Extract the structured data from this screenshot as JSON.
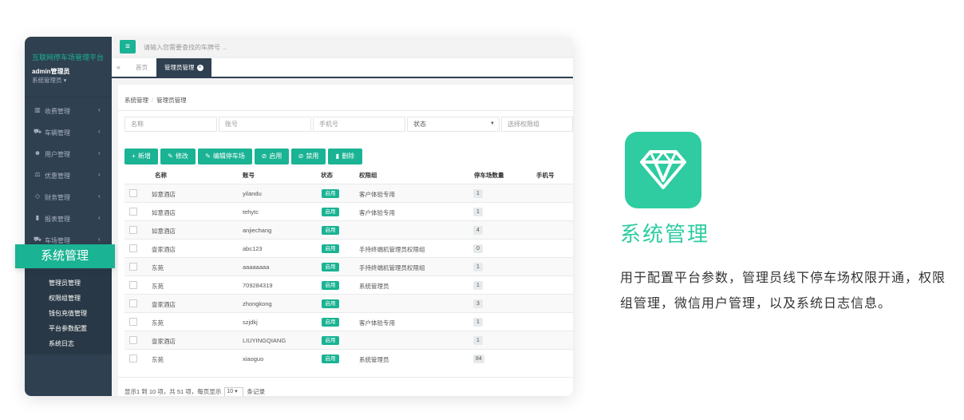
{
  "sidebar": {
    "brand": "互联网停车场管理平台",
    "user_name": "admin管理员",
    "user_role": "系统管理员 ▾",
    "items": [
      {
        "label": "收费管理",
        "icon": "barcode-icon"
      },
      {
        "label": "车辆管理",
        "icon": "car-icon"
      },
      {
        "label": "用户管理",
        "icon": "users-icon"
      },
      {
        "label": "优惠管理",
        "icon": "balance-scale-icon"
      },
      {
        "label": "财务管理",
        "icon": "diamond-icon"
      },
      {
        "label": "报表管理",
        "icon": "bar-chart-icon"
      },
      {
        "label": "车场管理",
        "icon": "car-icon"
      }
    ],
    "submenu": [
      "管理员管理",
      "权限组管理",
      "钱包充值管理",
      "平台参数配置",
      "系统日志"
    ]
  },
  "callout": "系统管理",
  "topbar": {
    "search_placeholder": "请输入您需要查找的车牌号 ..."
  },
  "tabs": [
    {
      "label": "首页",
      "active": false
    },
    {
      "label": "管理员管理",
      "active": true
    }
  ],
  "breadcrumb": [
    "系统管理",
    "管理员管理"
  ],
  "filters": {
    "name_placeholder": "名称",
    "account_placeholder": "账号",
    "phone_placeholder": "手机号",
    "status_label": "状态",
    "group_placeholder": "选择权限组"
  },
  "toolbar": {
    "add": "新增",
    "edit": "修改",
    "edit_lot": "编辑停车场",
    "enable": "启用",
    "disable": "禁用",
    "delete": "删除"
  },
  "table": {
    "headers": [
      "名称",
      "账号",
      "状态",
      "权限组",
      "停车场数量",
      "手机号"
    ],
    "rows": [
      {
        "name": "如意酒店",
        "account": "yilandu",
        "status": "启用",
        "group": "客户体验专用",
        "count": "1"
      },
      {
        "name": "如意酒店",
        "account": "tehytc",
        "status": "启用",
        "group": "客户体验专用",
        "count": "1"
      },
      {
        "name": "如意酒店",
        "account": "anjiechang",
        "status": "启用",
        "group": "",
        "count": "4"
      },
      {
        "name": "壹家酒店",
        "account": "abc123",
        "status": "启用",
        "group": "手持终端机管理员权限组",
        "count": "0"
      },
      {
        "name": "东苑",
        "account": "aaaaaaaa",
        "status": "启用",
        "group": "手持终端机管理员权限组",
        "count": "1"
      },
      {
        "name": "东苑",
        "account": "709284319",
        "status": "启用",
        "group": "系统管理员",
        "count": "1"
      },
      {
        "name": "壹家酒店",
        "account": "zhongkong",
        "status": "启用",
        "group": "",
        "count": "3"
      },
      {
        "name": "东苑",
        "account": "szjdkj",
        "status": "启用",
        "group": "客户体验专用",
        "count": "1"
      },
      {
        "name": "壹家酒店",
        "account": "LIUYINGQIANG",
        "status": "启用",
        "group": "",
        "count": "1"
      },
      {
        "name": "东苑",
        "account": "xiaoguo",
        "status": "启用",
        "group": "系统管理员",
        "count": "84"
      }
    ]
  },
  "pager": {
    "prefix": "显示1 到 10 项，共 51 项，每页显示",
    "page_size": "10",
    "suffix": "条记录"
  },
  "promo": {
    "title": "系统管理",
    "desc": "用于配置平台参数，管理员线下停车场权限开通，权限组管理，微信用户管理，以及系统日志信息。",
    "accent": "#2ecca0"
  }
}
